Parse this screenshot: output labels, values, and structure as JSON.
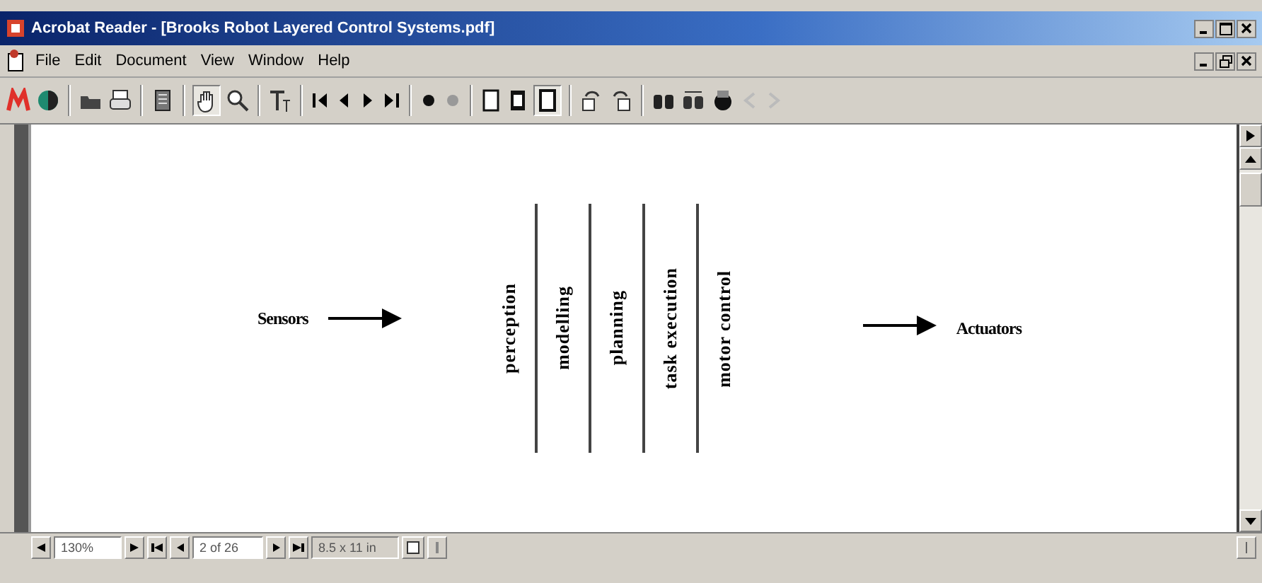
{
  "window": {
    "title": "Acrobat Reader - [Brooks Robot Layered Control Systems.pdf]"
  },
  "menu": [
    "File",
    "Edit",
    "Document",
    "View",
    "Window",
    "Help"
  ],
  "document": {
    "input_label": "Sensors",
    "output_label": "Actuators",
    "layers": [
      "perception",
      "modelling",
      "planning",
      "task execution",
      "motor control"
    ]
  },
  "status_bar": {
    "zoom": "130%",
    "page": "2 of 26",
    "page_size": "8.5 x 11 in"
  }
}
